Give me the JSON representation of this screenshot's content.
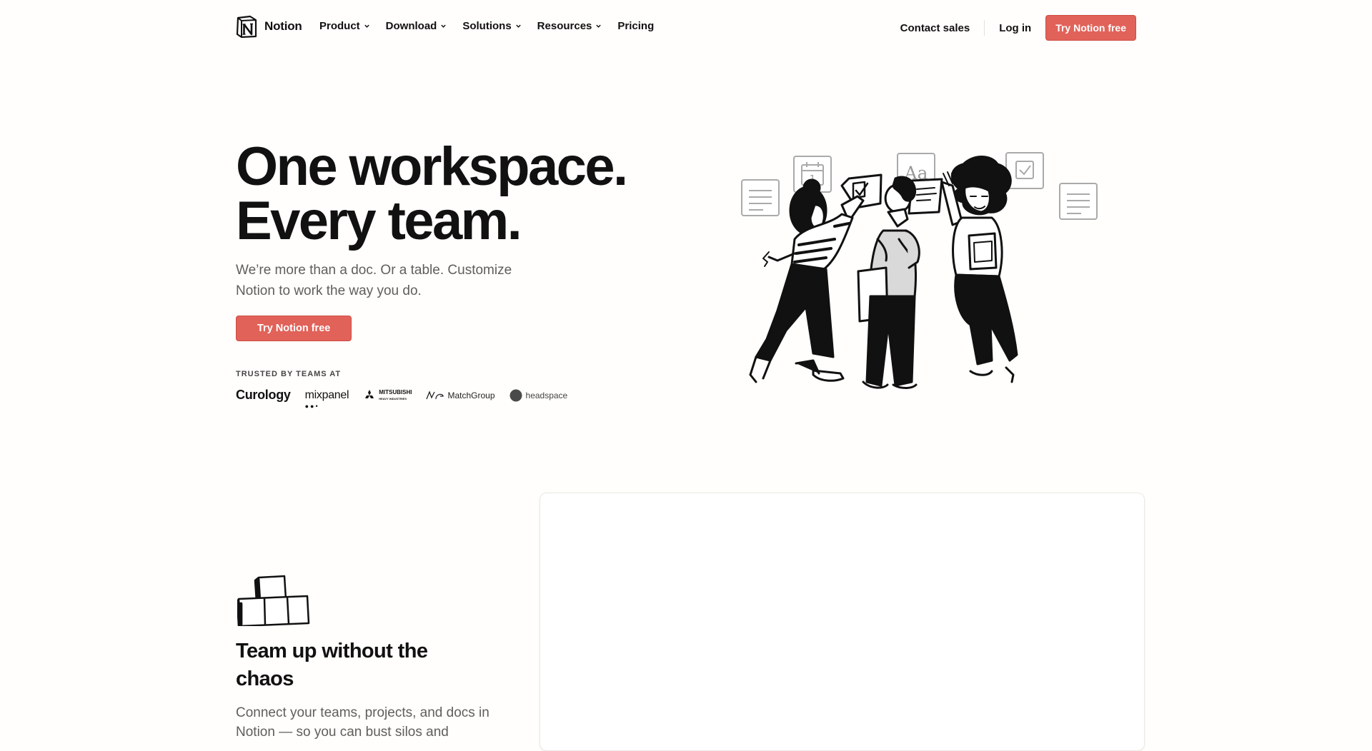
{
  "header": {
    "brand": "Notion",
    "nav": [
      {
        "label": "Product",
        "dropdown": true
      },
      {
        "label": "Download",
        "dropdown": true
      },
      {
        "label": "Solutions",
        "dropdown": true
      },
      {
        "label": "Resources",
        "dropdown": true
      },
      {
        "label": "Pricing",
        "dropdown": false
      }
    ],
    "contact_sales": "Contact sales",
    "login": "Log in",
    "cta": "Try Notion free"
  },
  "hero": {
    "title_line1": "One workspace.",
    "title_line2": "Every team.",
    "subtitle": "We’re more than a doc. Or a table. Customize Notion to work the way you do.",
    "cta": "Try Notion free",
    "trusted_label": "TRUSTED BY TEAMS AT",
    "logos": [
      "Curology",
      "mixpanel",
      "MITSUBISHI",
      "HEAVY INDUSTRIES",
      "MatchGroup",
      "headspace"
    ]
  },
  "illustration_text": {
    "aa": "Aa",
    "calendar_day": "1"
  },
  "feature": {
    "title": "Team up without the chaos",
    "text": "Connect your teams, projects, and docs in Notion — so you can bust silos and"
  },
  "colors": {
    "accent": "#e16259",
    "background": "#fffefc",
    "text": "#111111",
    "muted": "#5f5e5b"
  }
}
